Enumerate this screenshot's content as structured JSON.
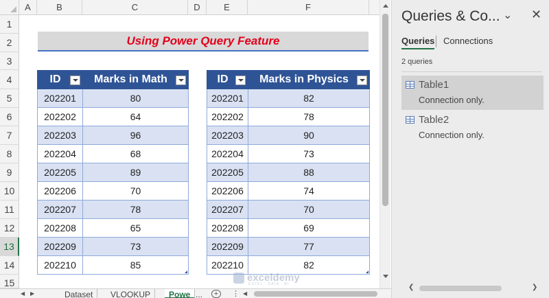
{
  "columns": [
    "A",
    "B",
    "C",
    "D",
    "E",
    "F"
  ],
  "rows": [
    "1",
    "2",
    "3",
    "4",
    "5",
    "6",
    "7",
    "8",
    "9",
    "10",
    "11",
    "12",
    "13",
    "14",
    "15"
  ],
  "title": "Using Power Query Feature",
  "table_math": {
    "headers": [
      "ID",
      "Marks in Math"
    ],
    "rows": [
      [
        "202201",
        "80"
      ],
      [
        "202202",
        "64"
      ],
      [
        "202203",
        "96"
      ],
      [
        "202204",
        "68"
      ],
      [
        "202205",
        "89"
      ],
      [
        "202206",
        "70"
      ],
      [
        "202207",
        "78"
      ],
      [
        "202208",
        "65"
      ],
      [
        "202209",
        "73"
      ],
      [
        "202210",
        "85"
      ]
    ]
  },
  "table_physics": {
    "headers": [
      "ID",
      "Marks in Physics"
    ],
    "rows": [
      [
        "202201",
        "82"
      ],
      [
        "202202",
        "78"
      ],
      [
        "202203",
        "90"
      ],
      [
        "202204",
        "73"
      ],
      [
        "202205",
        "88"
      ],
      [
        "202206",
        "74"
      ],
      [
        "202207",
        "70"
      ],
      [
        "202208",
        "69"
      ],
      [
        "202209",
        "77"
      ],
      [
        "202210",
        "82"
      ]
    ]
  },
  "watermark": {
    "name": "exceldemy",
    "tagline": "EXCEL · DATA · BI"
  },
  "sheet_tabs": [
    "Dataset",
    "VLOOKUP",
    "Powe"
  ],
  "sheet_tab_more": "...",
  "add_sheet": "+",
  "more_dots": "⋮",
  "queries_pane": {
    "title": "Queries & Co...",
    "chevron": "⌄",
    "close": "✕",
    "tab_queries": "Queries",
    "tab_connections": "Connections",
    "count": "2 queries",
    "items": [
      {
        "name": "Table1",
        "status": "Connection only."
      },
      {
        "name": "Table2",
        "status": "Connection only."
      }
    ]
  }
}
